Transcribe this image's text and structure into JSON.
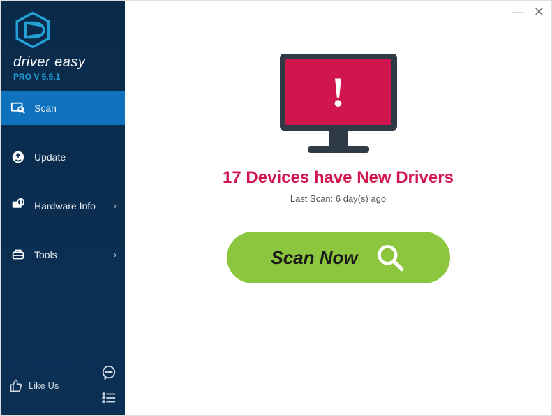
{
  "brand": {
    "name": "driver easy",
    "version": "PRO V 5.5.1"
  },
  "nav": {
    "scan": "Scan",
    "update": "Update",
    "hardware": "Hardware Info",
    "tools": "Tools"
  },
  "footer": {
    "like": "Like Us"
  },
  "main": {
    "headline": "17 Devices have New Drivers",
    "lastscan": "Last Scan: 6 day(s) ago",
    "scan_button": "Scan Now"
  },
  "colors": {
    "accent": "#0e72bf",
    "alert": "#d0154f",
    "action": "#8cc63f"
  }
}
